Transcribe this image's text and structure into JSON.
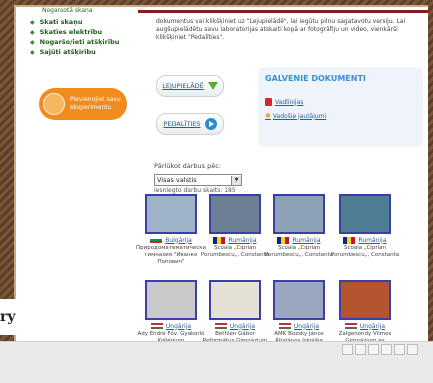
{
  "top_nav": {
    "truncated_item": "Nogarsotā skaņa"
  },
  "left_nav": {
    "items": [
      {
        "label": "Skati skaņu"
      },
      {
        "label": "Skaties elektrību"
      },
      {
        "label": "Nogaršo/ieti atšķirību"
      },
      {
        "label": "Sajūti atšķirību"
      }
    ],
    "promo_label": "Pievienojiet savu eksperimentu"
  },
  "intro_text": "dokumentus vai klikšķiniet uz \"Lejupielādē\", lai iegūtu pilnu sagatavotu versiju. Lai augšupielādētu savu laboratorijas atskaiti kopā ar fotogrāfiju un video, vienkārši klikšķiniet \"Pedalīties\".",
  "buttons": {
    "upload": "LEJUPIELĀDĒ",
    "share": "PEDALĪTIES"
  },
  "documents": {
    "title": "GALVENIE DOKUMENTI",
    "links": [
      "Vadlīnijas",
      "Vadošie jautājumi"
    ]
  },
  "filter": {
    "label": "Pārlūkot darbus pēc:",
    "selected": "Visas valstis",
    "count_label": "Iesniegto darbu skaits: 185"
  },
  "cards": [
    {
      "country": "Bulgārija",
      "school": "Природоматематическа гимназия \"Иванко Попович\"",
      "flag": "bg",
      "thumb": "#9fb3c9"
    },
    {
      "country": "Rumānija",
      "school": "Scoala „Ciprian Porumbescu„, Constanta",
      "flag": "ro",
      "thumb": "#6d7f95"
    },
    {
      "country": "Rumānija",
      "school": "Scoala „Ciprian Porumbescu„, Constanta",
      "flag": "ro",
      "thumb": "#8da3b5"
    },
    {
      "country": "Rumānija",
      "school": "Scoala „Ciprian Porumbescu„, Constanta",
      "flag": "ro",
      "thumb": "#4f7d94"
    },
    {
      "country": "Ungārija",
      "school": "Ady Endre Főv. Gyakorló Kollégium",
      "flag": "hu",
      "thumb": "#c9c9c9"
    },
    {
      "country": "Ungārija",
      "school": "Bethlen Gábor Református Gimnázium",
      "flag": "hu",
      "thumb": "#e4e0d6"
    },
    {
      "country": "Ungārija",
      "school": "ÁMK Bozsky János Általános Iskolája",
      "flag": "hu",
      "thumb": "#9aa7bf"
    },
    {
      "country": "Ungārija",
      "school": "Zalgenondy Vilmos Gimnázium és Informatikai",
      "flag": "hu",
      "thumb": "#b5552f"
    }
  ],
  "overlay_fragment": "ry",
  "colors": {
    "accent_green": "#5cab2a",
    "accent_orange": "#f08c1e",
    "accent_blue": "#3b8fd6",
    "thumb_border": "#3b3fa8"
  }
}
